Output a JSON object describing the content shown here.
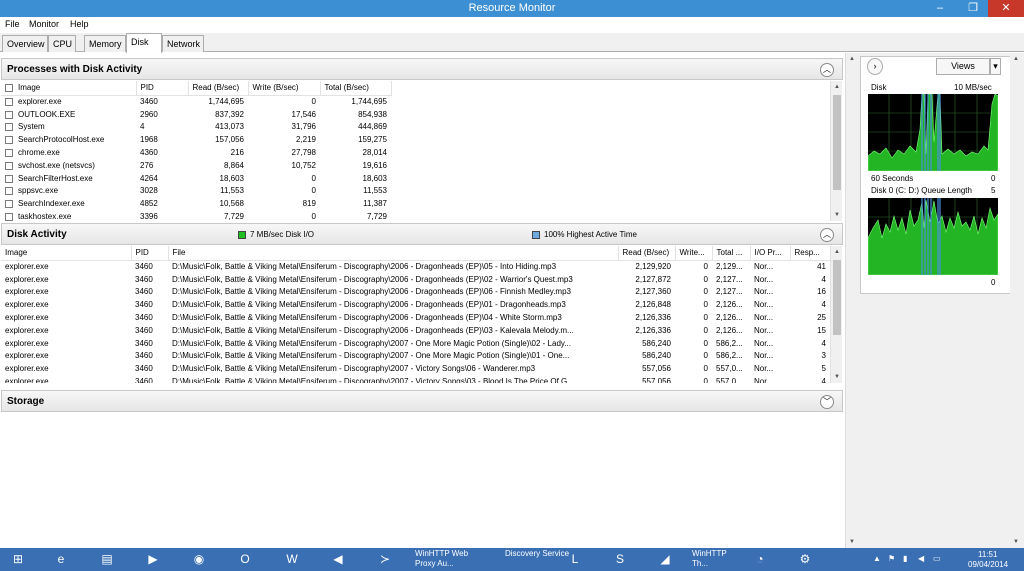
{
  "window": {
    "title": "Resource Monitor",
    "min": "–",
    "max": "❐",
    "close": "✕"
  },
  "menu": [
    "File",
    "Monitor",
    "Help"
  ],
  "tabs": [
    "Overview",
    "CPU",
    "Memory",
    "Disk",
    "Network"
  ],
  "processes": {
    "title": "Processes with Disk Activity",
    "collapse": "︿",
    "columns": [
      "Image",
      "PID",
      "Read (B/sec)",
      "Write (B/sec)",
      "Total (B/sec)"
    ],
    "rows": [
      [
        "explorer.exe",
        "3460",
        "1,744,695",
        "0",
        "1,744,695"
      ],
      [
        "OUTLOOK.EXE",
        "2960",
        "837,392",
        "17,546",
        "854,938"
      ],
      [
        "System",
        "4",
        "413,073",
        "31,796",
        "444,869"
      ],
      [
        "SearchProtocolHost.exe",
        "1968",
        "157,056",
        "2,219",
        "159,275"
      ],
      [
        "chrome.exe",
        "4360",
        "216",
        "27,798",
        "28,014"
      ],
      [
        "svchost.exe (netsvcs)",
        "276",
        "8,864",
        "10,752",
        "19,616"
      ],
      [
        "SearchFilterHost.exe",
        "4264",
        "18,603",
        "0",
        "18,603"
      ],
      [
        "sppsvc.exe",
        "3028",
        "11,553",
        "0",
        "11,553"
      ],
      [
        "SearchIndexer.exe",
        "4852",
        "10,568",
        "819",
        "11,387"
      ],
      [
        "taskhostex.exe",
        "3396",
        "7,729",
        "0",
        "7,729"
      ]
    ]
  },
  "disk_activity": {
    "title": "Disk Activity",
    "legend_io": "7 MB/sec Disk I/O",
    "legend_active": "100% Highest Active Time",
    "io_color": "#1fbf1f",
    "active_color": "#6fa8dc",
    "collapse": "︿",
    "columns": [
      "Image",
      "PID",
      "File",
      "Read (B/sec)",
      "Write...",
      "Total ...",
      "I/O Pr...",
      "Resp..."
    ],
    "rows": [
      [
        "explorer.exe",
        "3460",
        "D:\\Music\\Folk, Battle & Viking Metal\\Ensiferum - Discography\\2006 - Dragonheads (EP)\\05 - Into Hiding.mp3",
        "2,129,920",
        "0",
        "2,129...",
        "Nor...",
        "41"
      ],
      [
        "explorer.exe",
        "3460",
        "D:\\Music\\Folk, Battle & Viking Metal\\Ensiferum - Discography\\2006 - Dragonheads (EP)\\02 - Warrior's Quest.mp3",
        "2,127,872",
        "0",
        "2,127...",
        "Nor...",
        "4"
      ],
      [
        "explorer.exe",
        "3460",
        "D:\\Music\\Folk, Battle & Viking Metal\\Ensiferum - Discography\\2006 - Dragonheads (EP)\\06 - Finnish Medley.mp3",
        "2,127,360",
        "0",
        "2,127...",
        "Nor...",
        "16"
      ],
      [
        "explorer.exe",
        "3460",
        "D:\\Music\\Folk, Battle & Viking Metal\\Ensiferum - Discography\\2006 - Dragonheads (EP)\\01 - Dragonheads.mp3",
        "2,126,848",
        "0",
        "2,126...",
        "Nor...",
        "4"
      ],
      [
        "explorer.exe",
        "3460",
        "D:\\Music\\Folk, Battle & Viking Metal\\Ensiferum - Discography\\2006 - Dragonheads (EP)\\04 - White Storm.mp3",
        "2,126,336",
        "0",
        "2,126...",
        "Nor...",
        "25"
      ],
      [
        "explorer.exe",
        "3460",
        "D:\\Music\\Folk, Battle & Viking Metal\\Ensiferum - Discography\\2006 - Dragonheads (EP)\\03 - Kalevala Melody.m...",
        "2,126,336",
        "0",
        "2,126...",
        "Nor...",
        "15"
      ],
      [
        "explorer.exe",
        "3460",
        "D:\\Music\\Folk, Battle & Viking Metal\\Ensiferum - Discography\\2007 - One More Magic Potion (Single)\\02 - Lady...",
        "586,240",
        "0",
        "586,2...",
        "Nor...",
        "4"
      ],
      [
        "explorer.exe",
        "3460",
        "D:\\Music\\Folk, Battle & Viking Metal\\Ensiferum - Discography\\2007 - One More Magic Potion (Single)\\01 - One...",
        "586,240",
        "0",
        "586,2...",
        "Nor...",
        "3"
      ],
      [
        "explorer.exe",
        "3460",
        "D:\\Music\\Folk, Battle & Viking Metal\\Ensiferum - Discography\\2007 - Victory Songs\\06 - Wanderer.mp3",
        "557,056",
        "0",
        "557,0...",
        "Nor...",
        "5"
      ],
      [
        "explorer.exe",
        "3460",
        "D:\\Music\\Folk, Battle & Viking Metal\\Ensiferum - Discography\\2007 - Victory Songs\\03 - Blood Is The Price Of G...",
        "557,056",
        "0",
        "557,0...",
        "Nor...",
        "4"
      ]
    ]
  },
  "storage": {
    "title": "Storage",
    "expand": "﹀"
  },
  "side": {
    "views_label": "Views",
    "disk_graph": {
      "title": "Disk",
      "max": "10 MB/sec",
      "time": "60 Seconds",
      "min": "0"
    },
    "queue_graph": {
      "title": "Disk 0 (C: D:) Queue Length",
      "max": "5",
      "min": "0"
    }
  },
  "taskbar": {
    "proxy_label": "WinHTTP Web Proxy Au...",
    "discovery_label": "Discovery Service",
    "winhttp_label": "WinHTTP Th...",
    "time": "11:51",
    "date": "09/04/2014"
  }
}
